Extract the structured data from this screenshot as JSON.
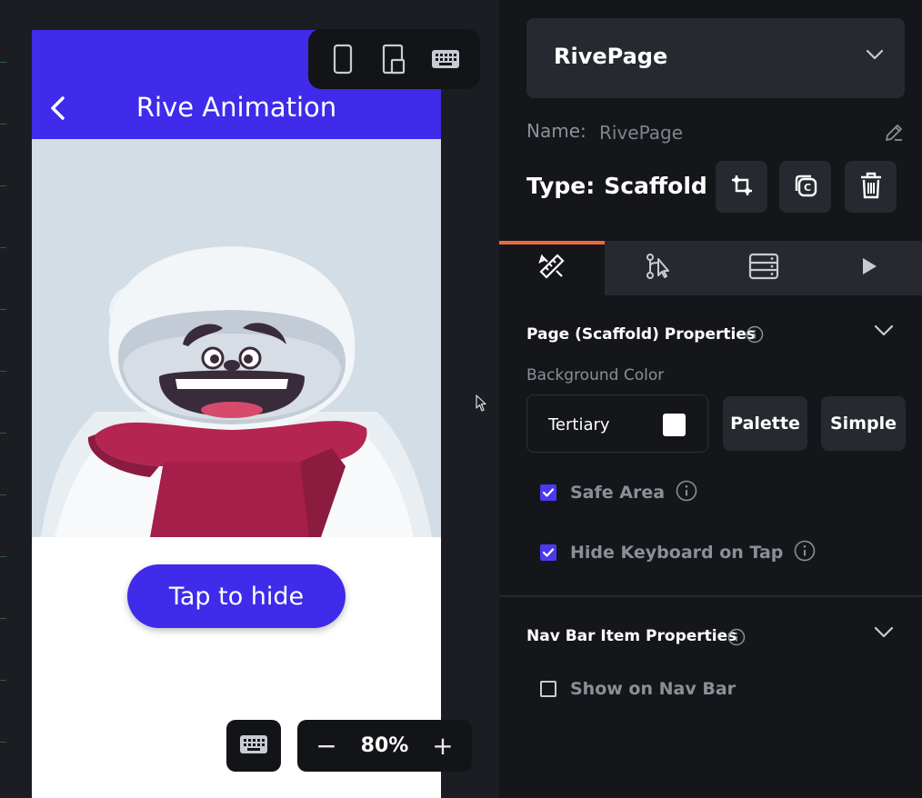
{
  "canvas": {
    "appbar": {
      "title": "Rive Animation",
      "back_icon": "chevron-left-icon",
      "color": "#3f2be9"
    },
    "hero": {
      "image": "polar-bear-illustration",
      "background": "#d3dde5"
    },
    "primary_button": {
      "label": "Tap to hide",
      "color": "#3f2be9"
    },
    "device_toolbar": {
      "icons": [
        "phone-icon",
        "tablet-icon",
        "keyboard-icon"
      ]
    },
    "keyboard_toggle": {
      "icon": "keyboard-icon"
    },
    "zoom": {
      "minus": "−",
      "value": "80%",
      "plus": "+"
    }
  },
  "panel": {
    "page_selector": {
      "value": "RivePage",
      "icon": "chevron-down-icon"
    },
    "name": {
      "label": "Name:",
      "value": "RivePage",
      "icon": "pencil-icon"
    },
    "type": {
      "label": "Type:",
      "value": "Scaffold"
    },
    "actions": [
      "crop-icon",
      "copy-icon",
      "trash-icon"
    ],
    "tabs": [
      {
        "name": "properties",
        "icon": "ruler-pencil-icon",
        "active": true
      },
      {
        "name": "actions",
        "icon": "flow-icon",
        "active": false
      },
      {
        "name": "backend-query",
        "icon": "database-icon",
        "active": false
      },
      {
        "name": "preview",
        "icon": "play-icon",
        "active": false
      }
    ],
    "accent": "#ee6a3e",
    "page_properties": {
      "title": "Page (Scaffold) Properties",
      "background_label": "Background Color",
      "background_value": "Tertiary",
      "swatch_color": "#ffffff",
      "palette_button": "Palette",
      "simple_button": "Simple",
      "safe_area_label": "Safe Area",
      "safe_area_checked": true,
      "hide_keyboard_label": "Hide Keyboard on Tap",
      "hide_keyboard_checked": true
    },
    "nav_bar_properties": {
      "title": "Nav Bar Item Properties",
      "show_label": "Show on Nav Bar",
      "show_checked": false
    }
  }
}
